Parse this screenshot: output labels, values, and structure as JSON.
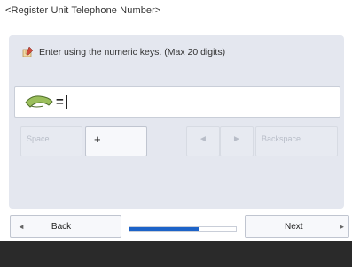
{
  "title": "<Register Unit Telephone Number>",
  "instruction": "Enter using the numeric keys. (Max 20 digits)",
  "input": {
    "prefix": "=",
    "value": ""
  },
  "keys": {
    "space": "Space",
    "plus": "+",
    "left": "◄",
    "right": "►",
    "backspace": "Backspace"
  },
  "nav": {
    "back_label": "Back",
    "back_arrow": "◄",
    "next_label": "Next",
    "next_arrow": "►"
  },
  "progress": {
    "fraction": 0.66
  },
  "colors": {
    "accent": "#1d63c8",
    "panel": "#e4e7ef",
    "footer": "#2a2a2a"
  },
  "icons": {
    "instruction": "pencil-note-icon",
    "phone": "telephone-handset-icon"
  }
}
